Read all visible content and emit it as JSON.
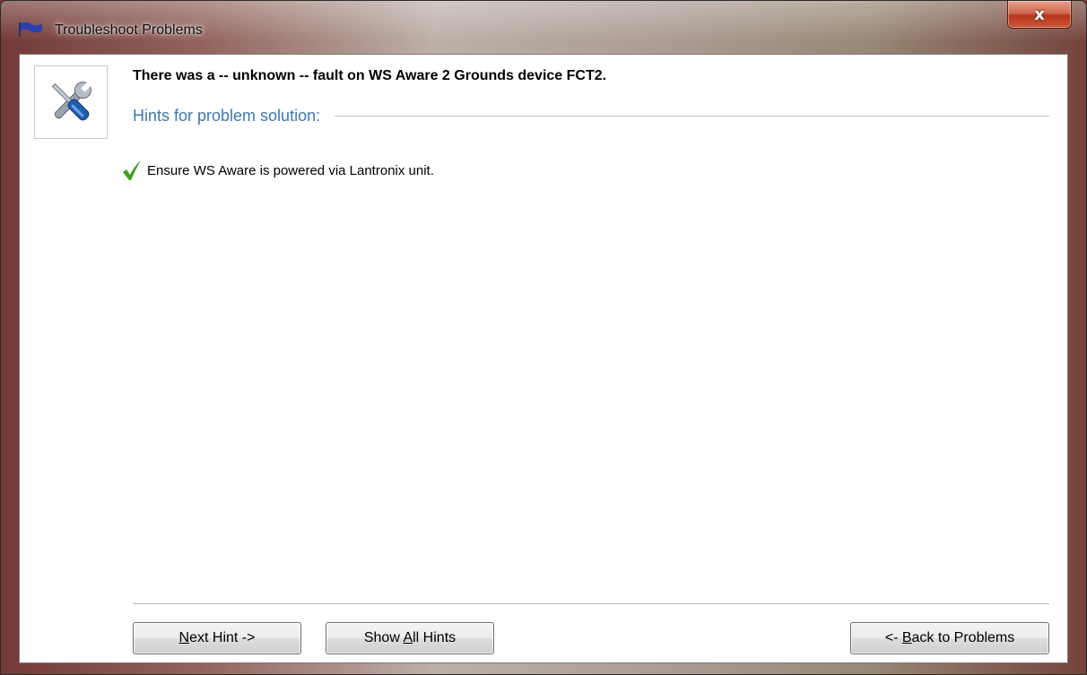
{
  "window": {
    "title": "Troubleshoot Problems",
    "close_symbol": "x",
    "title_icon": "flag-icon",
    "close_icon": "close-icon"
  },
  "header": {
    "icon": "tools-icon",
    "fault_message": "There was a -- unknown -- fault on WS Aware 2 Grounds device FCT2.",
    "hints_heading": "Hints for problem solution:"
  },
  "hints": [
    {
      "icon": "checkmark-icon",
      "text": "Ensure WS Aware is powered via Lantronix unit."
    }
  ],
  "buttons": {
    "next_hint": {
      "pre": "",
      "key": "N",
      "post": "ext Hint ->"
    },
    "show_all": {
      "pre": "Show ",
      "key": "A",
      "post": "ll Hints"
    },
    "back": {
      "pre": "<- ",
      "key": "B",
      "post": "ack to Problems"
    }
  },
  "colors": {
    "heading_blue": "#3c78b4",
    "check_green": "#3aa01e",
    "close_red": "#c8401e"
  }
}
